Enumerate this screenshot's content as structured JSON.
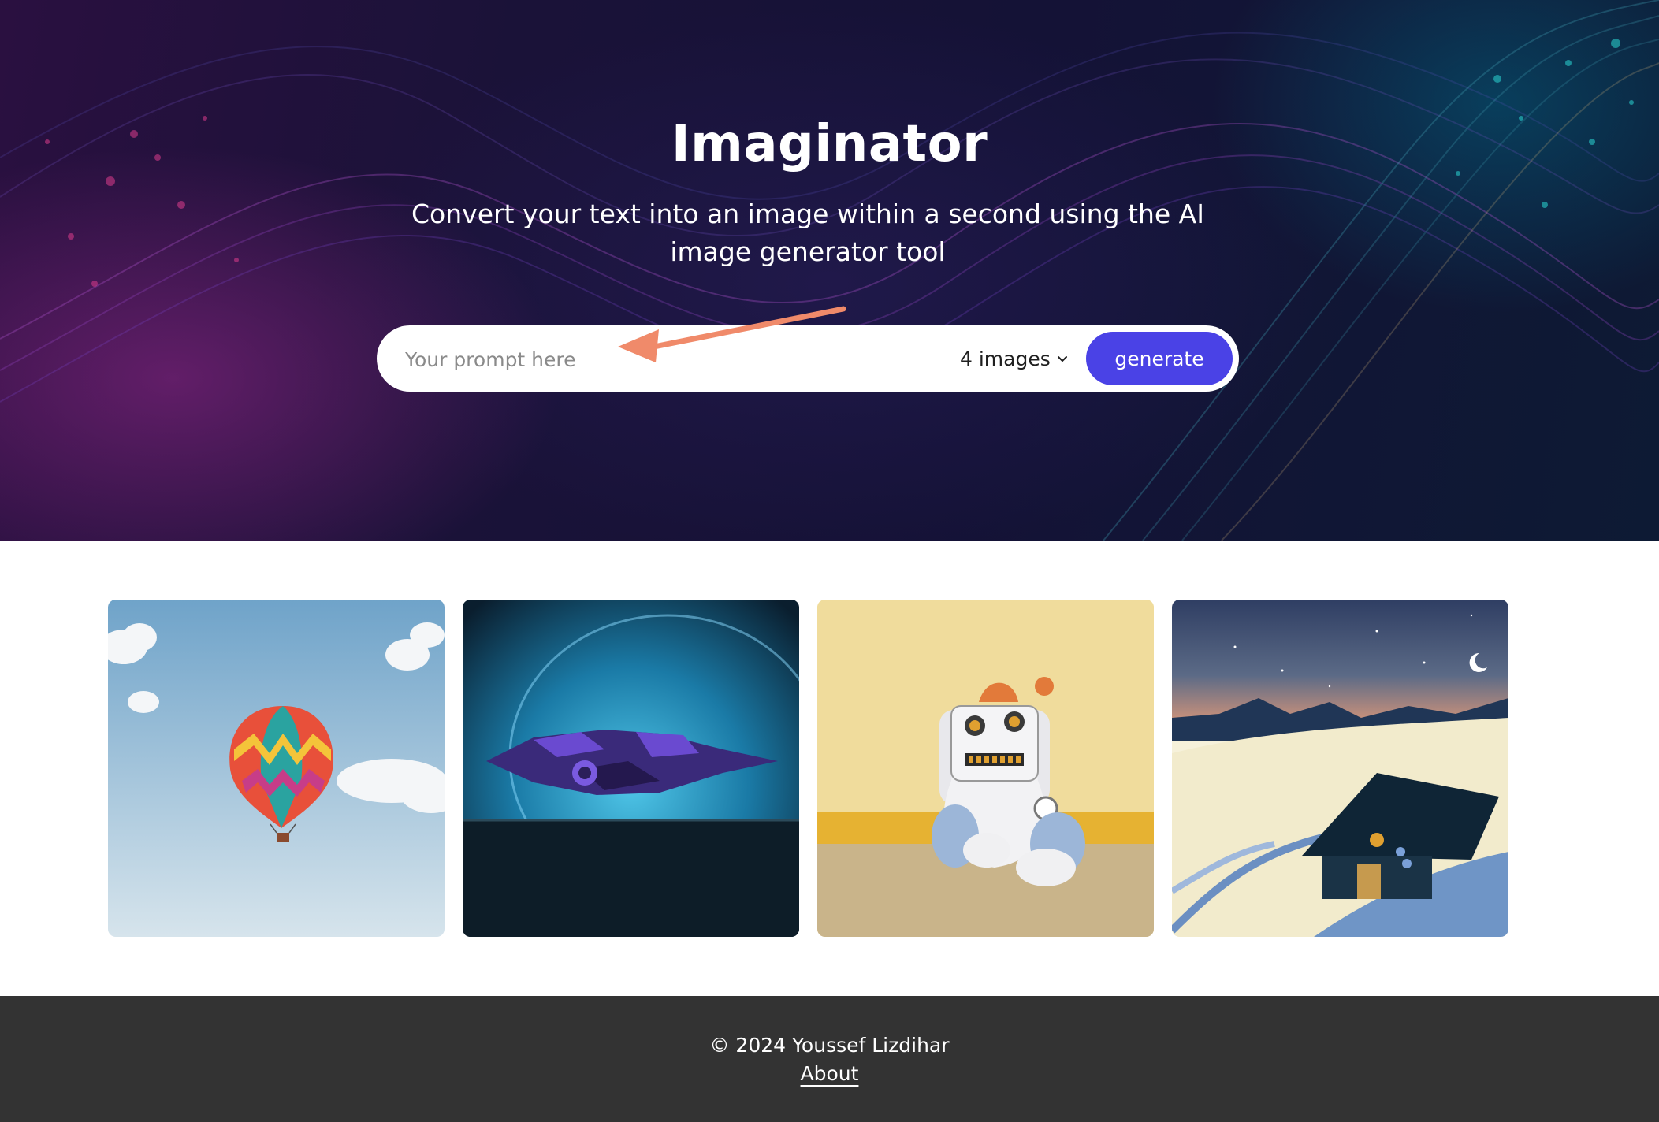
{
  "hero": {
    "title": "Imaginator",
    "subtitle": "Convert your text into an image within a second using the AI image generator tool"
  },
  "search": {
    "placeholder": "Your prompt here",
    "value": "",
    "image_count_selected": "4 images",
    "generate_label": "generate"
  },
  "gallery": {
    "images": [
      {
        "subject": "hot-air-balloon"
      },
      {
        "subject": "spaceship"
      },
      {
        "subject": "robot-plush"
      },
      {
        "subject": "snowy-cabin-night"
      }
    ]
  },
  "footer": {
    "copyright": "© 2024 Youssef Lizdihar",
    "about_label": "About"
  },
  "colors": {
    "accent": "#4a42e6",
    "footer_bg": "#333333",
    "annotation_arrow": "#f08a6a"
  }
}
